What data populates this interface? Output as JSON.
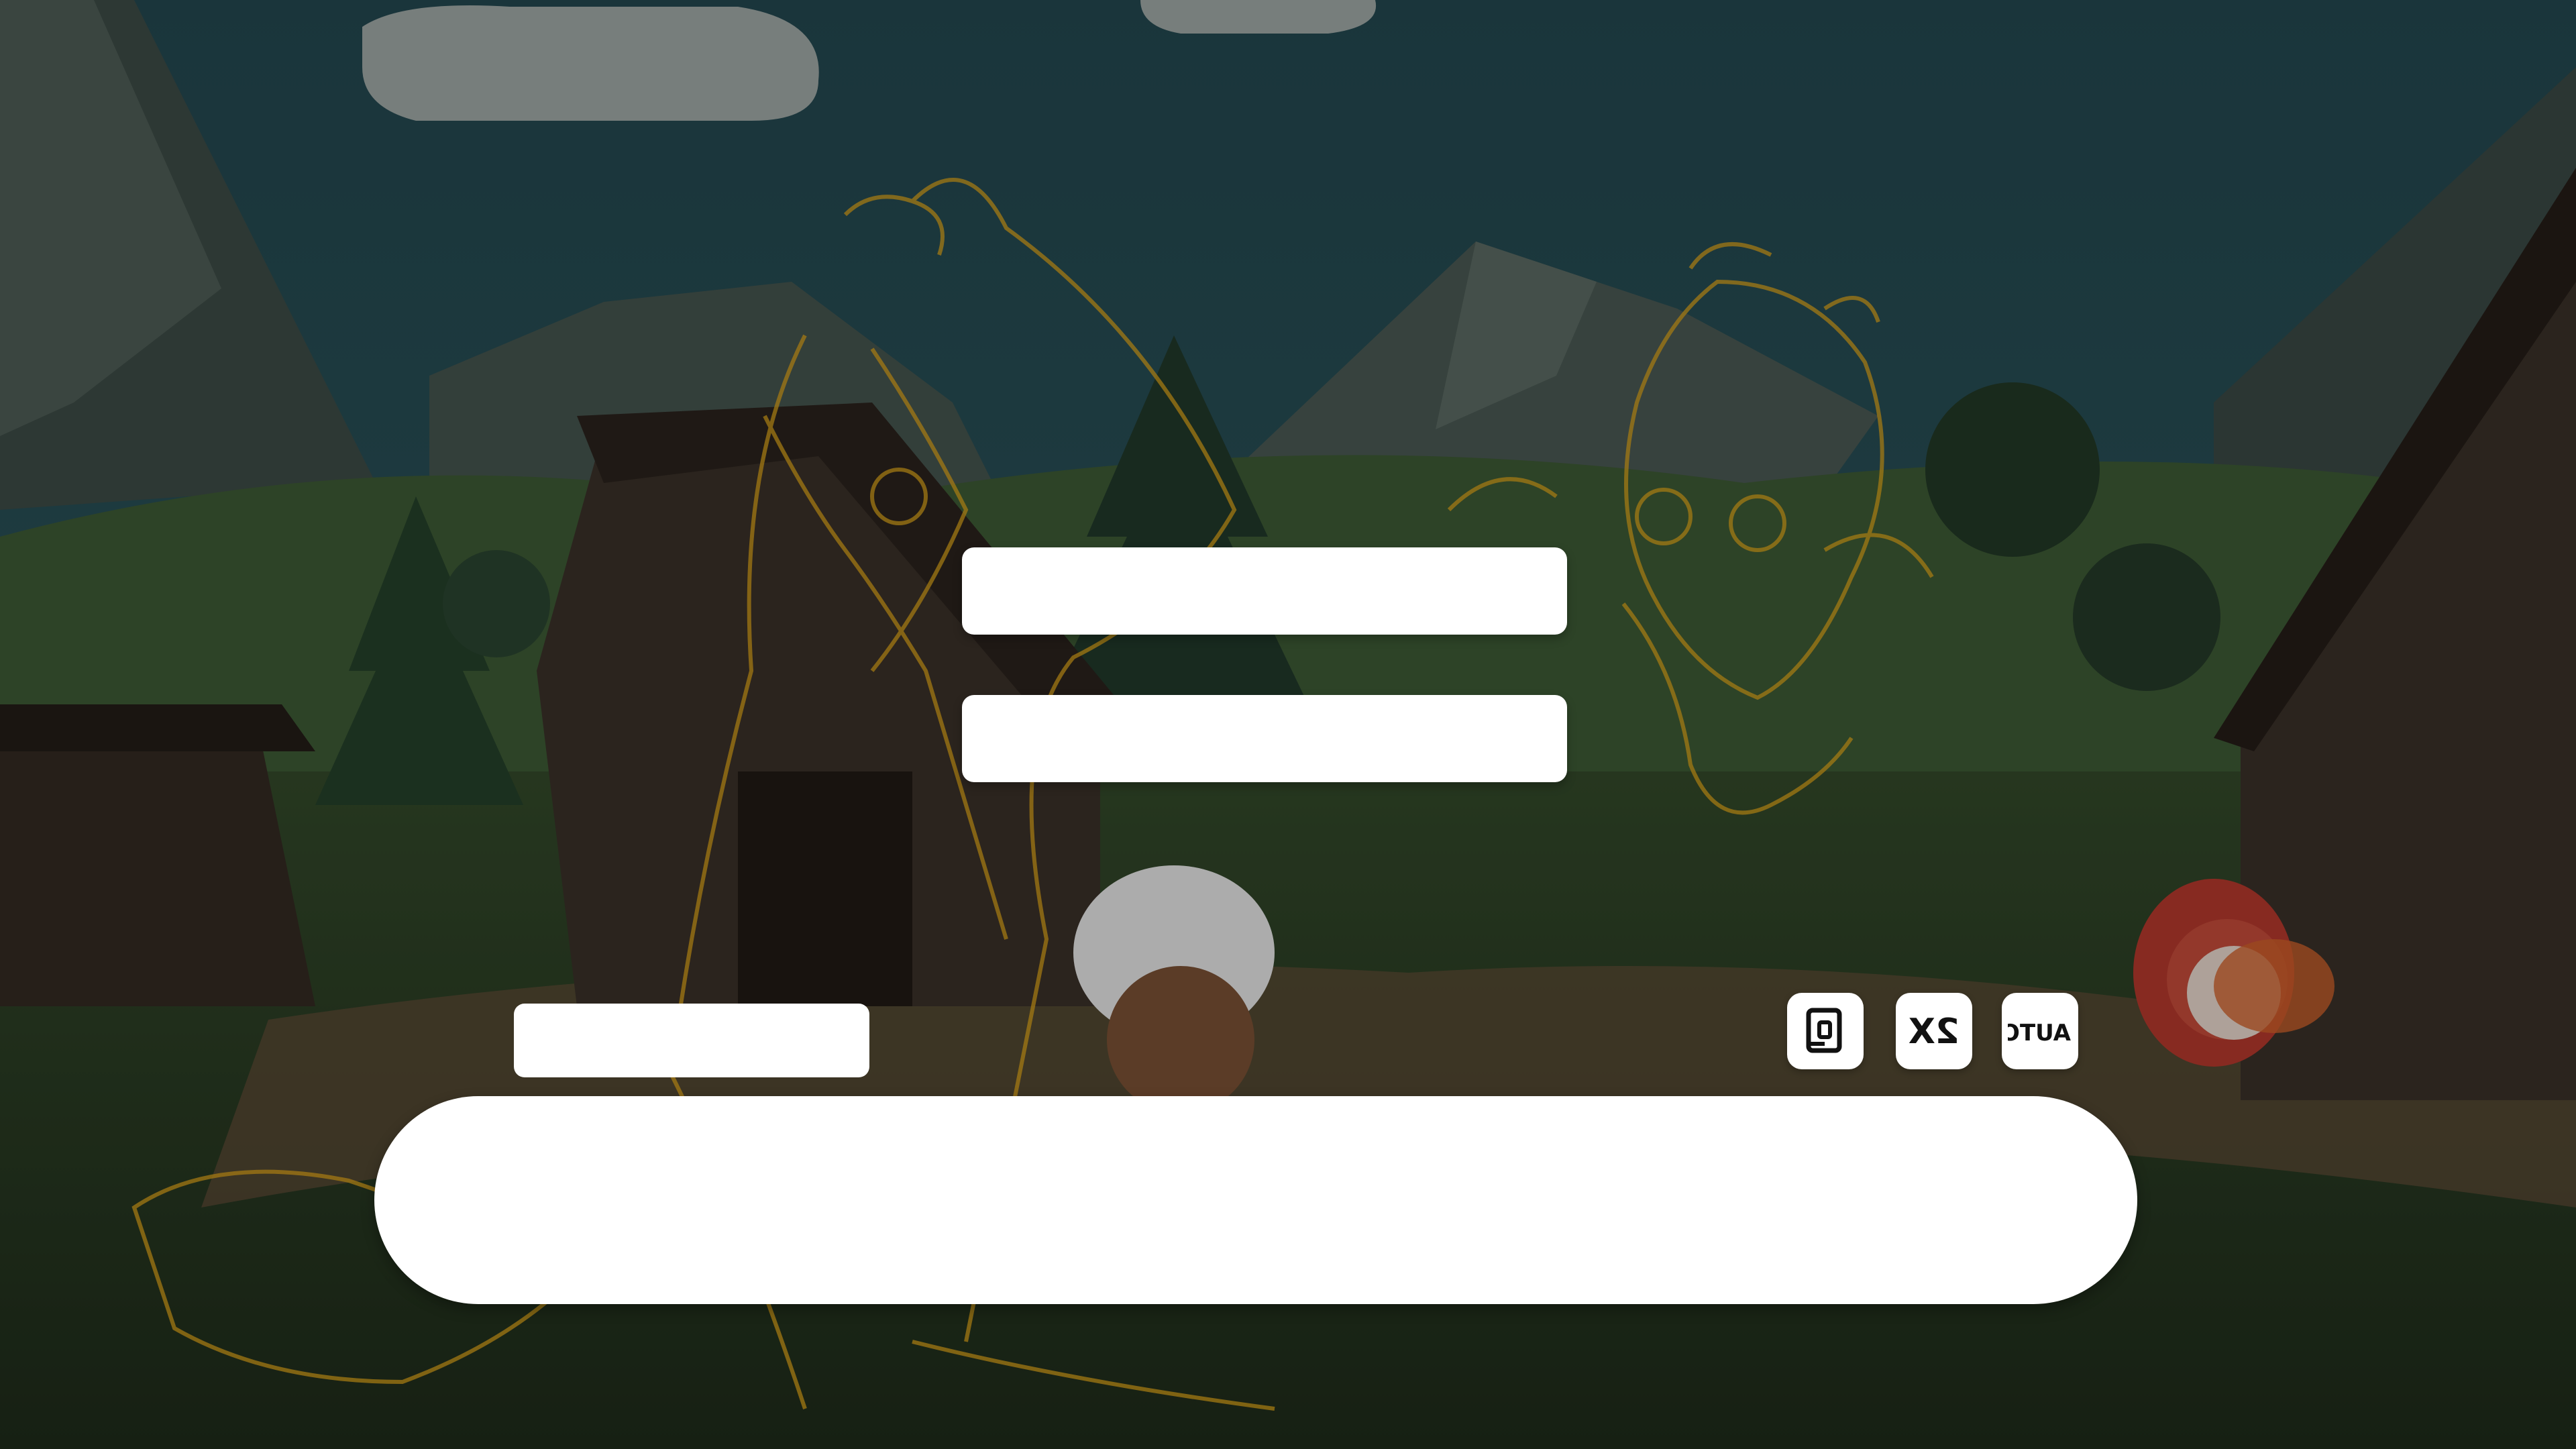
{
  "scene": {
    "description_icon": "village-scene"
  },
  "choices": [
    {
      "label": ""
    },
    {
      "label": ""
    }
  ],
  "speaker": {
    "name": ""
  },
  "dialog": {
    "text": ""
  },
  "controls": {
    "log_icon": "log-icon",
    "speed_label": "2X",
    "auto_label": "AUTO"
  },
  "colors": {
    "sketch": "#d9a21a",
    "panel": "#ffffff"
  }
}
